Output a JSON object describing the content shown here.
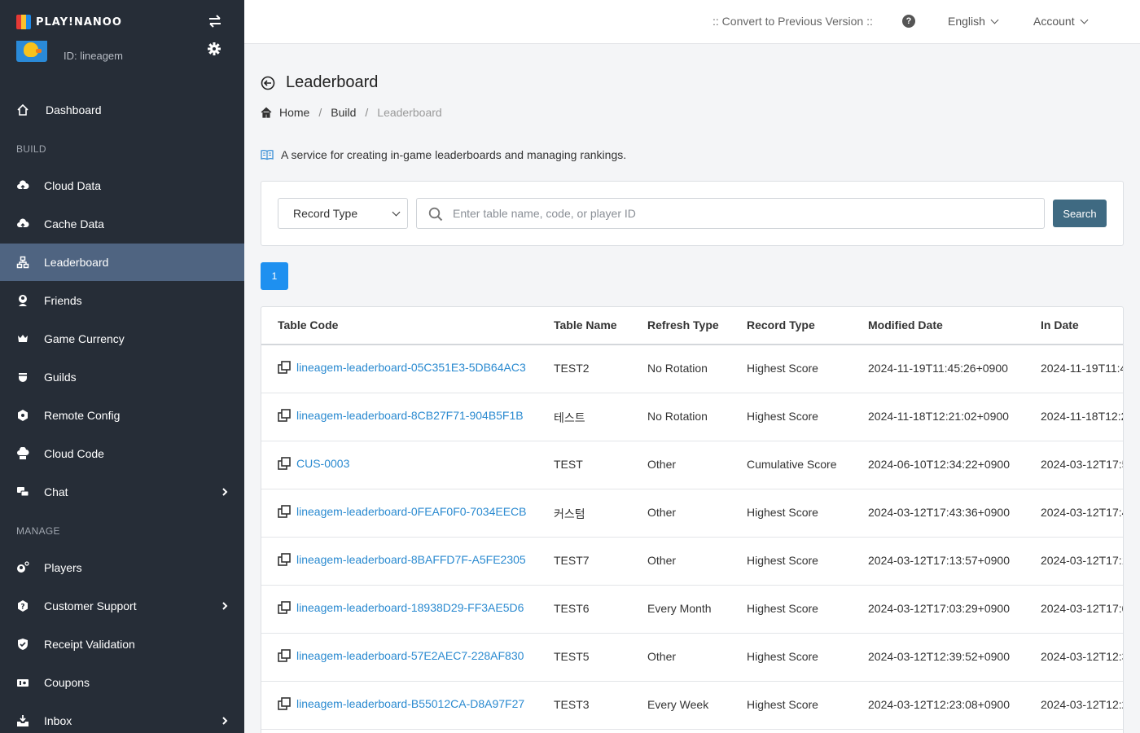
{
  "sidebar": {
    "logo_text": "PLAY!NANOO",
    "profile_id": "ID: lineagem",
    "sections": {
      "build": "BUILD",
      "manage": "MANAGE"
    },
    "items": [
      {
        "label": "Dashboard",
        "icon": "home-icon"
      },
      {
        "label": "Cloud Data",
        "icon": "cloud-icon"
      },
      {
        "label": "Cache Data",
        "icon": "cloud-icon"
      },
      {
        "label": "Leaderboard",
        "icon": "leaderboard-icon",
        "active": true
      },
      {
        "label": "Friends",
        "icon": "friends-icon"
      },
      {
        "label": "Game Currency",
        "icon": "currency-icon"
      },
      {
        "label": "Guilds",
        "icon": "guilds-icon"
      },
      {
        "label": "Remote Config",
        "icon": "config-icon"
      },
      {
        "label": "Cloud Code",
        "icon": "code-icon"
      },
      {
        "label": "Chat",
        "icon": "chat-icon",
        "has_submenu": true
      },
      {
        "label": "Players",
        "icon": "players-icon"
      },
      {
        "label": "Customer Support",
        "icon": "support-icon",
        "has_submenu": true
      },
      {
        "label": "Receipt Validation",
        "icon": "shield-icon"
      },
      {
        "label": "Coupons",
        "icon": "coupon-icon"
      },
      {
        "label": "Inbox",
        "icon": "inbox-icon",
        "has_submenu": true
      }
    ]
  },
  "topbar": {
    "convert": ":: Convert to Previous Version ::",
    "help": "?",
    "language": "English",
    "account": "Account"
  },
  "page": {
    "title": "Leaderboard",
    "breadcrumb": [
      "Home",
      "Build",
      "Leaderboard"
    ],
    "description": "A service for creating in-game leaderboards and managing rankings."
  },
  "search": {
    "select_value": "Record Type",
    "placeholder": "Enter table name, code, or player ID",
    "button": "Search"
  },
  "pagination": {
    "current": "1"
  },
  "table": {
    "columns": [
      "Table Code",
      "Table Name",
      "Refresh Type",
      "Record Type",
      "Modified Date",
      "In Date"
    ],
    "rows": [
      {
        "code": "lineagem-leaderboard-05C351E3-5DB64AC3",
        "name": "TEST2",
        "refresh": "No Rotation",
        "record": "Highest Score",
        "modified": "2024-11-19T11:45:26+0900",
        "indate": "2024-11-19T11:4"
      },
      {
        "code": "lineagem-leaderboard-8CB27F71-904B5F1B",
        "name": "테스트",
        "refresh": "No Rotation",
        "record": "Highest Score",
        "modified": "2024-11-18T12:21:02+0900",
        "indate": "2024-11-18T12:2"
      },
      {
        "code": "CUS-0003",
        "name": "TEST",
        "refresh": "Other",
        "record": "Cumulative Score",
        "modified": "2024-06-10T12:34:22+0900",
        "indate": "2024-03-12T17:5"
      },
      {
        "code": "lineagem-leaderboard-0FEAF0F0-7034EECB",
        "name": "커스텀",
        "refresh": "Other",
        "record": "Highest Score",
        "modified": "2024-03-12T17:43:36+0900",
        "indate": "2024-03-12T17:4"
      },
      {
        "code": "lineagem-leaderboard-8BAFFD7F-A5FE2305",
        "name": "TEST7",
        "refresh": "Other",
        "record": "Highest Score",
        "modified": "2024-03-12T17:13:57+0900",
        "indate": "2024-03-12T17:1"
      },
      {
        "code": "lineagem-leaderboard-18938D29-FF3AE5D6",
        "name": "TEST6",
        "refresh": "Every Month",
        "record": "Highest Score",
        "modified": "2024-03-12T17:03:29+0900",
        "indate": "2024-03-12T17:0"
      },
      {
        "code": "lineagem-leaderboard-57E2AEC7-228AF830",
        "name": "TEST5",
        "refresh": "Other",
        "record": "Highest Score",
        "modified": "2024-03-12T12:39:52+0900",
        "indate": "2024-03-12T12:3"
      },
      {
        "code": "lineagem-leaderboard-B55012CA-D8A97F27",
        "name": "TEST3",
        "refresh": "Every Week",
        "record": "Highest Score",
        "modified": "2024-03-12T12:23:08+0900",
        "indate": "2024-03-12T12:2"
      }
    ]
  },
  "colors": {
    "sidebar_bg": "#262d37",
    "sidebar_active": "#4f6481",
    "link": "#2a8ad0",
    "primary_button": "#3f6a82",
    "pagination_active": "#1e90f0"
  }
}
